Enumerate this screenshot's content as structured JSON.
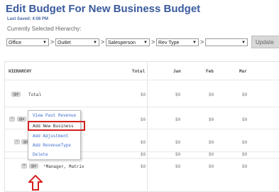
{
  "page": {
    "title": "Edit Budget For New Business Budget",
    "last_saved": "Last Saved: 4:08 PM",
    "hierarchy_label": "Currently Selected Hierarchy:"
  },
  "selectors": [
    {
      "value": "Office"
    },
    {
      "value": "Outlet"
    },
    {
      "value": "Salesperson"
    },
    {
      "value": "Rev Type"
    },
    {
      "value": ""
    }
  ],
  "separator": ">",
  "update_label": "Update",
  "table": {
    "headers": [
      "HIERARCHY",
      "Total",
      "Jan",
      "Feb",
      "Mar"
    ],
    "total_row": {
      "label": "Total",
      "values": [
        "$0",
        "$0",
        "$0",
        "$0"
      ]
    },
    "rows": [
      {
        "values": [
          "$0",
          "$0",
          "$0",
          "$0"
        ]
      },
      {
        "values": [
          "$0",
          "$0",
          "$0",
          "$0"
        ]
      },
      {
        "values": [
          "$0",
          "$0",
          "$0",
          "$0"
        ]
      },
      {
        "label": "*Manager, Matrix",
        "values": [
          "$0",
          "$0",
          "$0",
          "$0"
        ]
      }
    ]
  },
  "context_menu": {
    "items": [
      "View Past Revenue",
      "Add New Business",
      "Add Adjustment",
      "Add RevenueType",
      "Delete"
    ],
    "highlighted_index": 1
  },
  "colors": {
    "title": "#3a5a9c",
    "link": "#3a6ad0",
    "highlight": "#d62020"
  }
}
